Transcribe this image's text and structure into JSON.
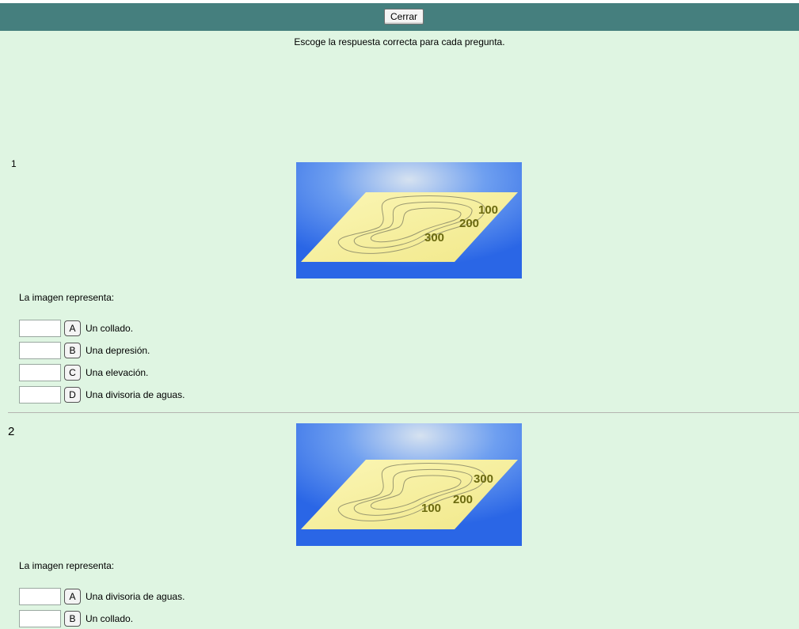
{
  "toolbar": {
    "close_label": "Cerrar"
  },
  "instructions": "Escoge la respuesta correcta para cada pregunta.",
  "colors": {
    "toolbar": "#457f7e",
    "background": "#dff5e2",
    "map_blue": "#2f6fe8",
    "map_sheet": "#f4ec9a",
    "contour_label": "#6b6a10"
  },
  "questions": [
    {
      "number": "1",
      "image": {
        "icon": "contour-map-image",
        "labels": [
          "100",
          "200",
          "300"
        ]
      },
      "prompt": "La imagen representa:",
      "options": [
        {
          "letter": "A",
          "text": "Un collado."
        },
        {
          "letter": "B",
          "text": "Una depresión."
        },
        {
          "letter": "C",
          "text": "Una elevación."
        },
        {
          "letter": "D",
          "text": "Una divisoria de aguas."
        }
      ]
    },
    {
      "number": "2",
      "image": {
        "icon": "contour-map-image",
        "labels": [
          "300",
          "200",
          "100"
        ]
      },
      "prompt": "La imagen representa:",
      "options": [
        {
          "letter": "A",
          "text": "Una divisoria de aguas."
        },
        {
          "letter": "B",
          "text": "Un collado."
        }
      ]
    }
  ]
}
